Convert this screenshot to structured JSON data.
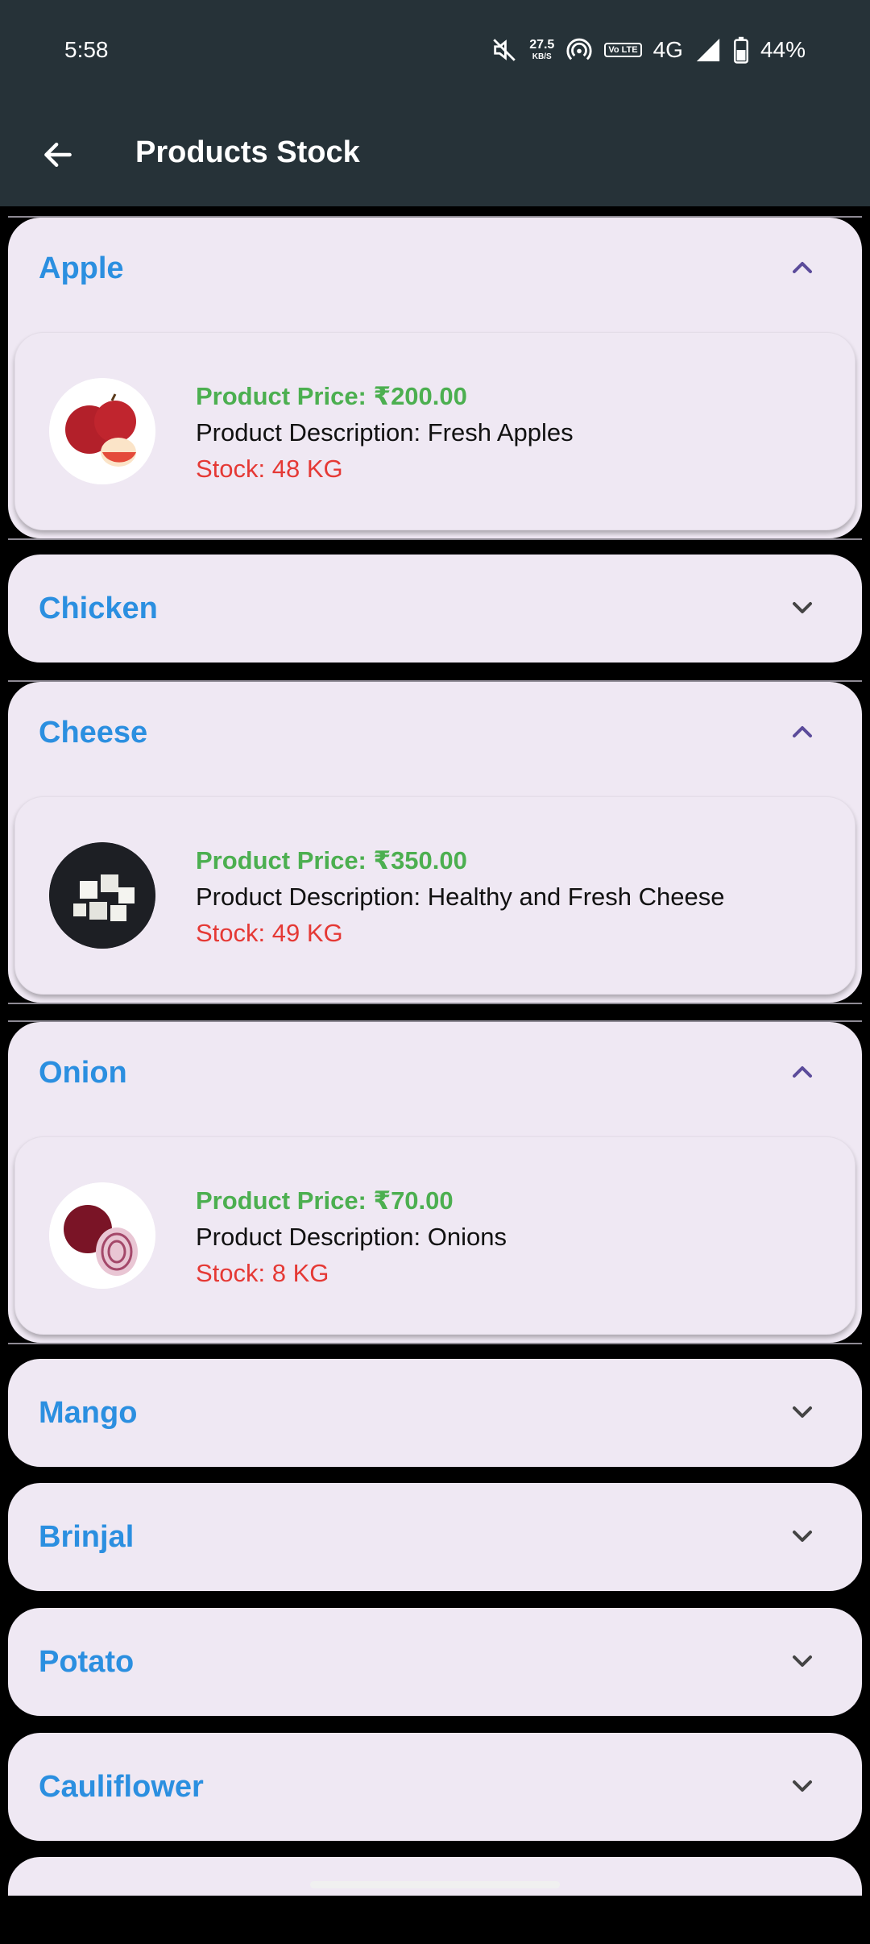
{
  "status": {
    "time": "5:58",
    "speed_value": "27.5",
    "speed_unit": "KB/S",
    "volte": "Vo LTE",
    "network": "4G",
    "battery": "44%"
  },
  "appbar": {
    "title": "Products Stock"
  },
  "products": [
    {
      "name": "Apple",
      "expanded": true,
      "price": "Product Price: ₹200.00",
      "description": "Product Description: Fresh Apples",
      "stock": "Stock: 48 KG",
      "image": "apple"
    },
    {
      "name": "Chicken",
      "expanded": false
    },
    {
      "name": "Cheese",
      "expanded": true,
      "price": "Product Price: ₹350.00",
      "description": "Product Description: Healthy and Fresh Cheese",
      "stock": "Stock: 49 KG",
      "image": "cheese"
    },
    {
      "name": "Onion",
      "expanded": true,
      "price": "Product Price: ₹70.00",
      "description": "Product Description: Onions",
      "stock": "Stock: 8 KG",
      "image": "onion"
    },
    {
      "name": "Mango",
      "expanded": false
    },
    {
      "name": "Brinjal",
      "expanded": false
    },
    {
      "name": "Potato",
      "expanded": false
    },
    {
      "name": "Cauliflower",
      "expanded": false
    }
  ],
  "colors": {
    "appbar": "#263238",
    "title": "#2b8fe0",
    "price": "#4caf50",
    "stock": "#e53935",
    "card": "#efe8f3"
  }
}
